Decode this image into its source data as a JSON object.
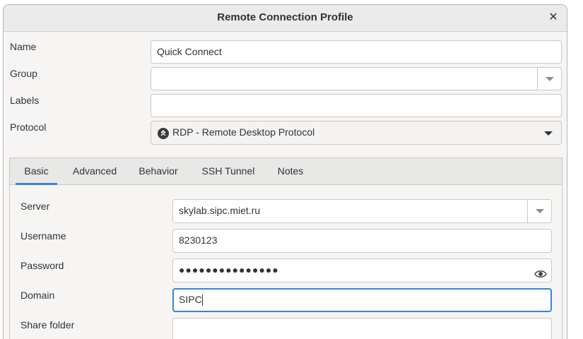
{
  "window": {
    "title": "Remote Connection Profile"
  },
  "form": {
    "name_label": "Name",
    "name_value": "Quick Connect",
    "group_label": "Group",
    "group_value": "",
    "labels_label": "Labels",
    "labels_value": "",
    "protocol_label": "Protocol",
    "protocol_value": "RDP - Remote Desktop Protocol"
  },
  "tabs": [
    {
      "label": "Basic",
      "active": true
    },
    {
      "label": "Advanced"
    },
    {
      "label": "Behavior"
    },
    {
      "label": "SSH Tunnel"
    },
    {
      "label": "Notes"
    }
  ],
  "basic": {
    "server_label": "Server",
    "server_value": "skylab.sipc.miet.ru",
    "username_label": "Username",
    "username_value": "8230123",
    "password_label": "Password",
    "password_value": "●●●●●●●●●●●●●●●",
    "domain_label": "Domain",
    "domain_value": "SIPC",
    "share_label": "Share folder",
    "share_value": ""
  },
  "colors": {
    "accent": "#3584e4",
    "window_bg": "#f6f5f4"
  },
  "icons": {
    "close": "close-icon",
    "protocol": "rdp-protocol-icon",
    "reveal": "eye-icon"
  }
}
